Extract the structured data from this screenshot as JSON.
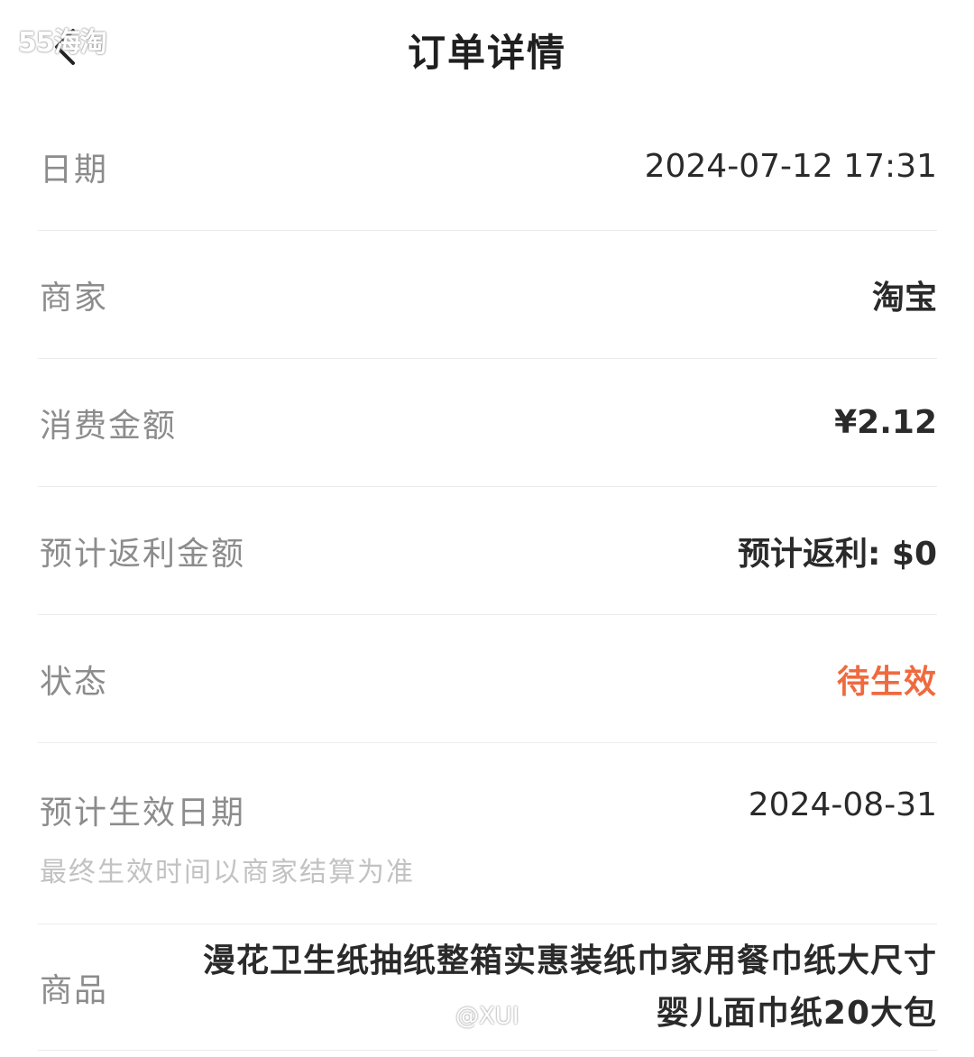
{
  "header": {
    "title": "订单详情"
  },
  "watermarks": {
    "logo": "55海淘",
    "user": "@XUI"
  },
  "rows": [
    {
      "label": "日期",
      "value": "2024-07-12 17:31"
    },
    {
      "label": "商家",
      "value": "淘宝"
    },
    {
      "label": "消费金额",
      "value": "¥2.12"
    },
    {
      "label": "预计返利金额",
      "value": "预计返利: $0"
    },
    {
      "label": "状态",
      "value": "待生效"
    },
    {
      "label": "预计生效日期",
      "value": "2024-08-31",
      "note": "最终生效时间以商家结算为准"
    },
    {
      "label": "商品",
      "value": "漫花卫生纸抽纸整箱实惠装纸巾家用餐巾纸大尺寸婴儿面巾纸20大包"
    }
  ],
  "colors": {
    "status": "#ef6a3f",
    "label": "#8c8c8c",
    "note": "#c2c2c2"
  },
  "icons": {
    "back": "chevron-left-icon"
  }
}
